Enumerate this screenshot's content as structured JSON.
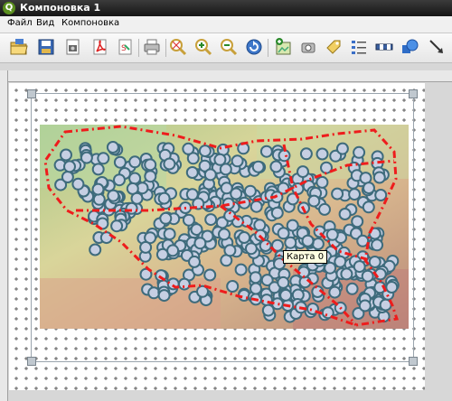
{
  "window": {
    "title": "Компоновка 1",
    "app_icon": "qgis-icon"
  },
  "menu": {
    "file": "Файл",
    "view": "Вид",
    "layout": "Компоновка"
  },
  "toolbar": {
    "buttons": [
      "open-icon",
      "save-icon",
      "export-image-icon",
      "export-pdf-icon",
      "export-svg-icon",
      "print-icon",
      "zoom-full-icon",
      "zoom-in-icon",
      "zoom-out-icon",
      "refresh-icon",
      "add-map-icon",
      "add-image-icon",
      "add-label-icon",
      "add-legend-icon",
      "add-scalebar-icon",
      "add-shape-icon",
      "add-arrow-icon"
    ]
  },
  "canvas": {
    "map_item_tooltip": "Карта 0"
  },
  "colors": {
    "boundary": "#ee1c1c",
    "point_fill": "#c6cfe3",
    "point_stroke": "#3e6b7c"
  }
}
